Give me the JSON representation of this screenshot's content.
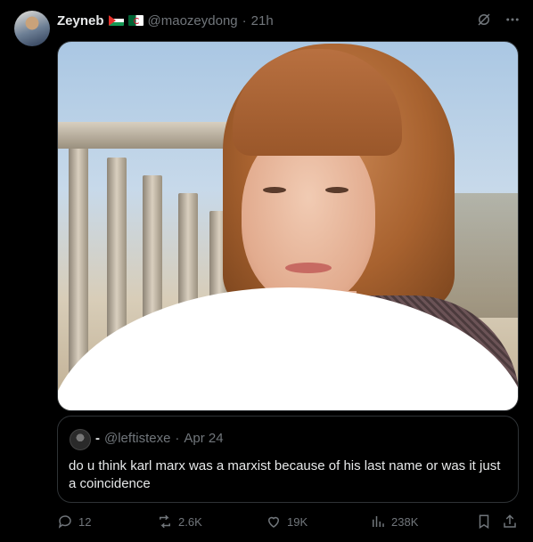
{
  "tweet": {
    "author_name": "Zeyneb",
    "flags": [
      "palestine-flag",
      "algeria-flag"
    ],
    "handle": "@maozeydong",
    "separator": "·",
    "time": "21h"
  },
  "quoted": {
    "name": "-",
    "handle": "@leftistexe",
    "separator": "·",
    "date": "Apr 24",
    "text": "do u think karl marx was a marxist because of his last name or was it just a coincidence"
  },
  "actions": {
    "replies": "12",
    "reposts": "2.6K",
    "likes": "19K",
    "views": "238K"
  },
  "colors": {
    "background": "#000000",
    "primary_text": "#e7e9ea",
    "secondary_text": "#71767b",
    "border": "#2f3336"
  }
}
